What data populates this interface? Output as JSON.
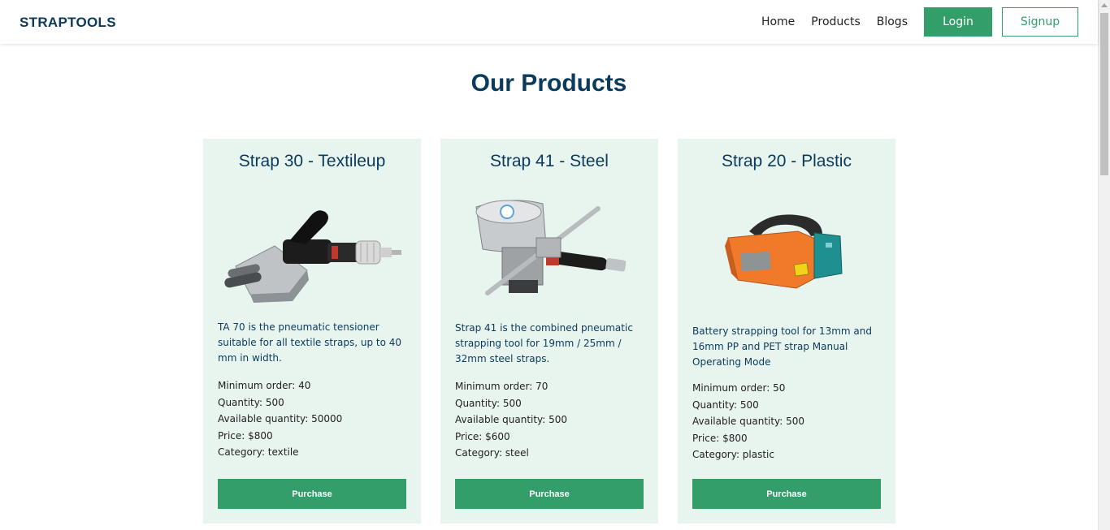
{
  "navbar": {
    "brand": "STRAPTOOLS",
    "links": [
      "Home",
      "Products",
      "Blogs"
    ],
    "login_label": "Login",
    "signup_label": "Signup"
  },
  "page_title": "Our Products",
  "products": [
    {
      "title": "Strap 30 - Textileup",
      "image_icon": "pneumatic-tensioner-tool-image",
      "description": "TA 70 is the pneumatic tensioner suitable for all textile straps, up to 40 mm in width.",
      "minimum_order": "Minimum order: 40",
      "quantity": "Quantity: 500",
      "available_quantity": "Available quantity: 50000",
      "price": "Price: $800",
      "category": "Category: textile",
      "button_label": "Purchase"
    },
    {
      "title": "Strap 41 - Steel",
      "image_icon": "combined-strapping-tool-image",
      "description": "Strap 41 is the combined pneumatic strapping tool for 19mm / 25mm / 32mm steel straps.",
      "minimum_order": "Minimum order: 70",
      "quantity": "Quantity: 500",
      "available_quantity": "Available quantity: 500",
      "price": "Price: $600",
      "category": "Category: steel",
      "button_label": "Purchase"
    },
    {
      "title": "Strap 20 - Plastic",
      "image_icon": "battery-strapping-tool-image",
      "description": "Battery strapping tool for 13mm and 16mm PP and PET strap Manual Operating Mode",
      "minimum_order": "Minimum order: 50",
      "quantity": "Quantity: 500",
      "available_quantity": "Available quantity: 500",
      "price": "Price: $800",
      "category": "Category: plastic",
      "button_label": "Purchase"
    }
  ],
  "colors": {
    "brand": "#0a3a5c",
    "accent": "#339e6a",
    "card_bg": "#e8f4ee"
  }
}
